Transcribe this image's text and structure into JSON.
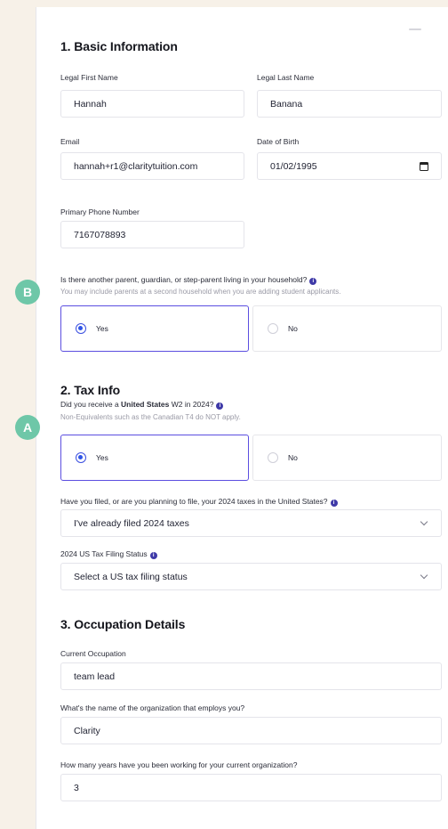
{
  "markers": {
    "b": "B",
    "a": "A"
  },
  "basic": {
    "title": "1. Basic Information",
    "first_name": {
      "label": "Legal First Name",
      "value": "Hannah"
    },
    "last_name": {
      "label": "Legal Last Name",
      "value": "Banana"
    },
    "email": {
      "label": "Email",
      "value": "hannah+r1@claritytuition.com"
    },
    "dob": {
      "label": "Date of Birth",
      "value": "01/02/1995",
      "icon": "calendar-icon"
    },
    "phone": {
      "label": "Primary Phone Number",
      "value": "7167078893"
    },
    "household": {
      "question": "Is there another parent, guardian, or step-parent living in your household?",
      "hint": "You may include parents at a second household when you are adding student applicants.",
      "yes": "Yes",
      "no": "No",
      "selected": "Yes"
    }
  },
  "tax": {
    "title": "2. Tax Info",
    "w2": {
      "question_prefix": "Did you receive a ",
      "question_bold": "United States",
      "question_suffix": " W2 in 2024?",
      "hint": "Non-Equivalents such as the Canadian T4 do NOT apply.",
      "yes": "Yes",
      "no": "No",
      "selected": "Yes"
    },
    "filed": {
      "label": "Have you filed, or are you planning to file, your 2024 taxes in the United States?",
      "value": "I've already filed 2024 taxes"
    },
    "status": {
      "label": "2024 US Tax Filing Status",
      "value": "Select a US tax filing status"
    }
  },
  "occupation": {
    "title": "3. Occupation Details",
    "current": {
      "label": "Current Occupation",
      "value": "team lead"
    },
    "employer": {
      "label": "What's the name of the organization that employs you?",
      "value": "Clarity"
    },
    "years": {
      "label": "How many years have you been working for your current organization?",
      "value": "3"
    }
  },
  "colors": {
    "accent": "#5b4ee0",
    "radio": "#2f55e6",
    "marker": "#6ec7a8",
    "info": "#3f3aa8",
    "background": "#f7f1e8"
  }
}
